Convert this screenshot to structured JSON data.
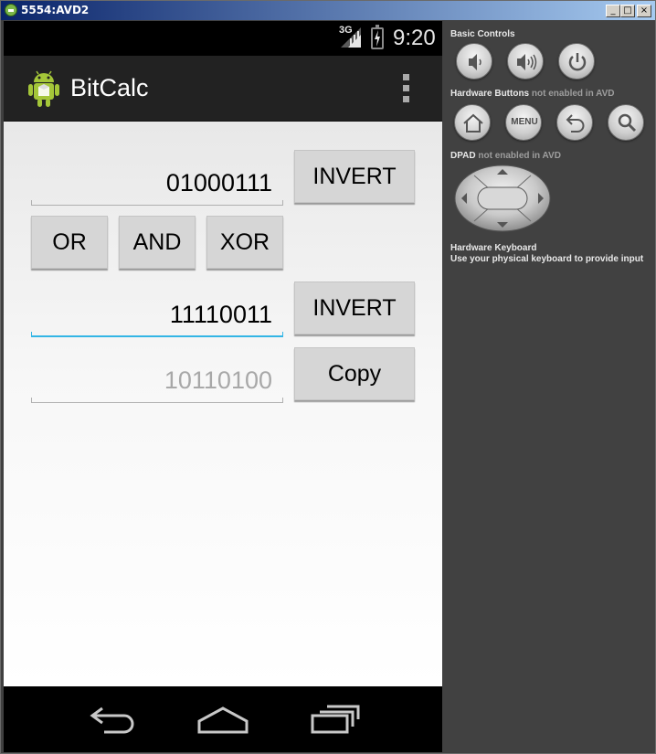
{
  "window": {
    "title": "5554:AVD2",
    "controls": [
      "minimize",
      "maximize",
      "close"
    ]
  },
  "statusbar": {
    "network": "3G",
    "time": "9:20"
  },
  "actionbar": {
    "app_title": "BitCalc",
    "logo_icon": "android-robot-icon",
    "overflow_icon": "overflow-menu-icon"
  },
  "main": {
    "input_a": {
      "value": "01000111"
    },
    "invert_a_label": "INVERT",
    "op_buttons": {
      "or": "OR",
      "and": "AND",
      "xor": "XOR"
    },
    "input_b": {
      "value": "11110011"
    },
    "invert_b_label": "INVERT",
    "result": {
      "value": "10110100"
    },
    "copy_label": "Copy",
    "accent_color": "#33b5e5"
  },
  "navbar": {
    "back_icon": "back-icon",
    "home_icon": "home-icon",
    "recents_icon": "recents-icon"
  },
  "side_panel": {
    "basic_controls": "Basic Controls",
    "hardware_buttons": "Hardware Buttons",
    "hardware_buttons_note": "not enabled in AVD",
    "menu_label": "MENU",
    "dpad": "DPAD",
    "dpad_note": "not enabled in AVD",
    "keyboard_title": "Hardware Keyboard",
    "keyboard_note": "Use your physical keyboard to provide input"
  }
}
